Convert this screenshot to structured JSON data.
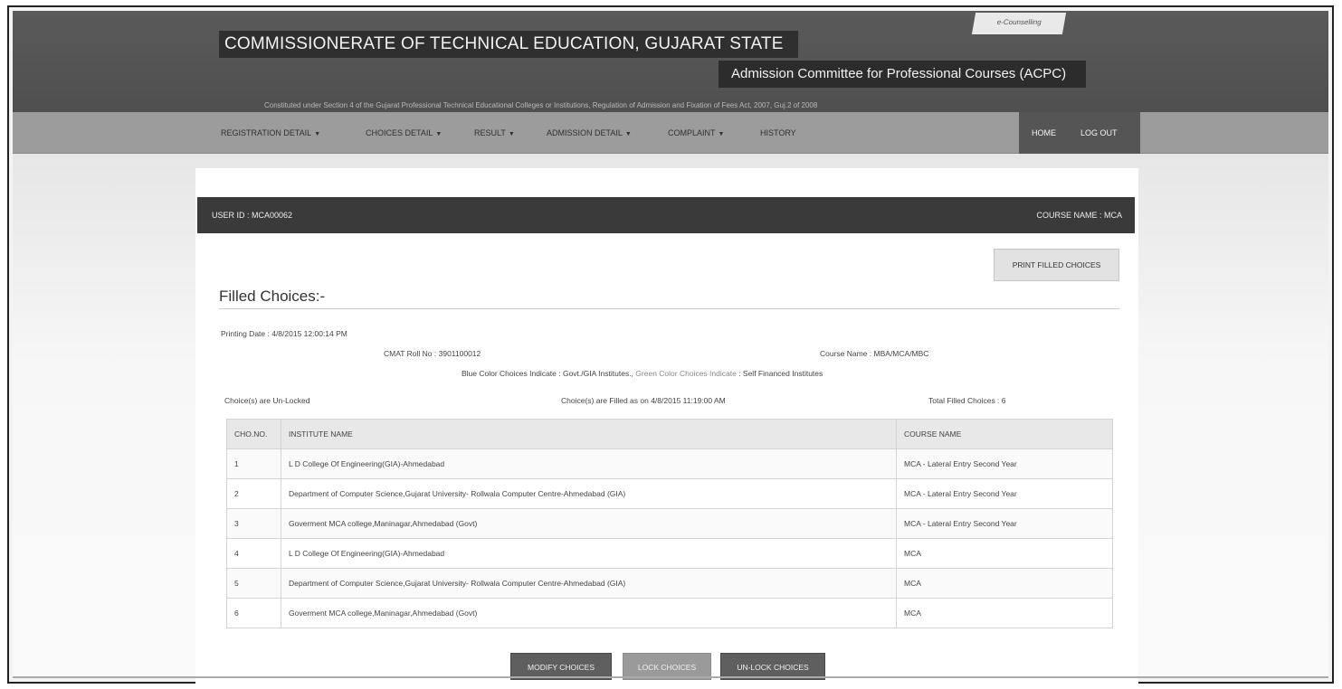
{
  "header": {
    "title": "COMMISSIONERATE OF TECHNICAL EDUCATION, GUJARAT STATE",
    "subtitle": "Admission Committee for Professional Courses (ACPC)",
    "tagline": "Constituted under Section 4 of the Gujarat Professional Technical Educational Colleges or Institutions, Regulation of Admission and Fixation of Fees Act, 2007, Guj.2 of 2008",
    "tab_label": "e-Counselling"
  },
  "nav": {
    "items": [
      {
        "label": "REGISTRATION DETAIL",
        "dropdown": true
      },
      {
        "label": "CHOICES DETAIL",
        "dropdown": true
      },
      {
        "label": "RESULT",
        "dropdown": true
      },
      {
        "label": "ADMISSION DETAIL",
        "dropdown": true
      },
      {
        "label": "COMPLAINT",
        "dropdown": true
      },
      {
        "label": "HISTORY",
        "dropdown": false
      }
    ],
    "home": "HOME",
    "logout": "LOG OUT",
    "caret": "▼"
  },
  "userbar": {
    "user_id": "USER ID : MCA00062",
    "course_name": "COURSE NAME : MCA"
  },
  "print_button": "PRINT FILLED CHOICES",
  "section_title": "Filled Choices:-",
  "info": {
    "printing_date": "Printing Date : 4/8/2015 12:00:14 PM",
    "cmat_roll": "CMAT Roll No : 3901100012",
    "course_name": "Course Name : MBA/MCA/MBC",
    "legend_blue": "Blue Color Choices Indicate : Govt./GIA Institutes.,",
    "legend_green": "Green Color Choices Indicate",
    "legend_green_value": ": Self Financed Institutes",
    "lock_status": "Choice(s) are Un-Locked",
    "filled_on": "Choice(s) are Filled as on 4/8/2015 11:19:00 AM",
    "total_filled": "Total Filled Choices : 6"
  },
  "table": {
    "headers": [
      "CHO.NO.",
      "INSTITUTE NAME",
      "COURSE NAME"
    ],
    "rows": [
      [
        "1",
        "L D College Of Engineering(GIA)-Ahmedabad",
        "MCA - Lateral Entry Second Year"
      ],
      [
        "2",
        "Department of Computer Science,Gujarat University- Rollwala Computer Centre-Ahmedabad (GIA)",
        "MCA - Lateral Entry Second Year"
      ],
      [
        "3",
        "Goverment MCA college,Maninagar,Ahmedabad (Govt)",
        "MCA - Lateral Entry Second Year"
      ],
      [
        "4",
        "L D College Of Engineering(GIA)-Ahmedabad",
        "MCA"
      ],
      [
        "5",
        "Department of Computer Science,Gujarat University- Rollwala Computer Centre-Ahmedabad (GIA)",
        "MCA"
      ],
      [
        "6",
        "Goverment MCA college,Maninagar,Ahmedabad (Govt)",
        "MCA"
      ]
    ]
  },
  "buttons": {
    "modify": "MODIFY CHOICES",
    "lock": "LOCK CHOICES",
    "unlock": "UN-LOCK CHOICES"
  },
  "colors": {
    "banner": "#555555",
    "navbar": "#9c9c9c",
    "userbar": "#3a3a3a"
  }
}
